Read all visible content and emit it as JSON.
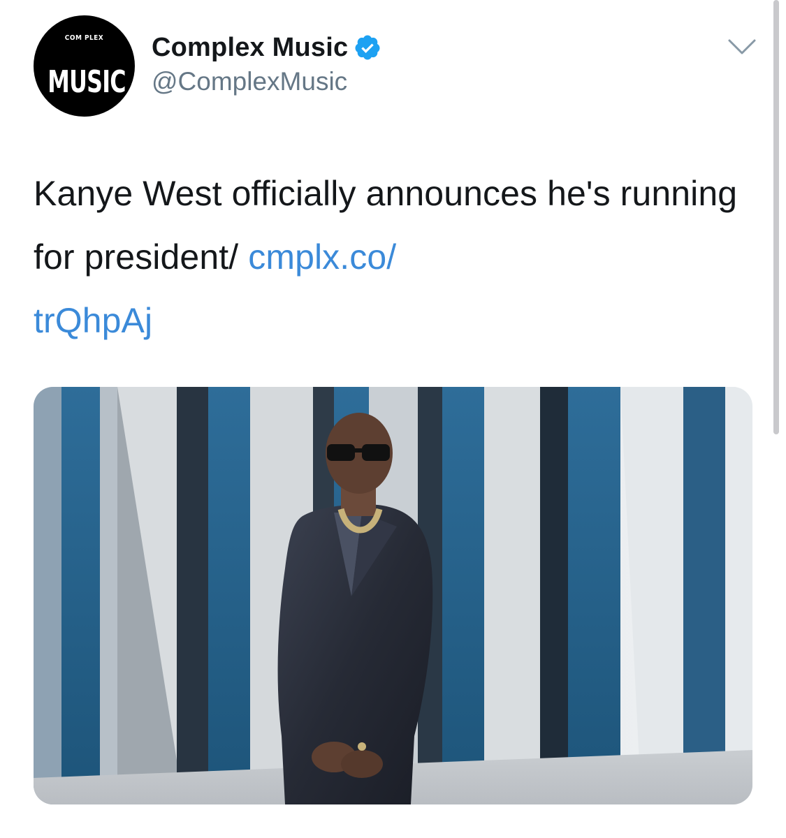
{
  "tweet": {
    "avatar": {
      "logo_top": "COM PLEX",
      "logo_main": "MUSIC",
      "icon": "complex-music-logo"
    },
    "author": {
      "display_name": "Complex Music",
      "handle": "@ComplexMusic",
      "verified": true
    },
    "menu_icon": "chevron-down-icon",
    "text": "Kanye West officially announces he's running for president/ ",
    "link": "cmplx.co/trQhpAj",
    "link_display_line1": "cmplx.co/",
    "link_display_line2": "trQhpAj",
    "media": {
      "description": "photo-of-man-in-leather-suit-and-sunglasses",
      "icon": "photo-media"
    }
  },
  "colors": {
    "link": "#3b8ad9",
    "verified": "#1da1f2",
    "handle": "#657786",
    "text": "#14171a"
  }
}
